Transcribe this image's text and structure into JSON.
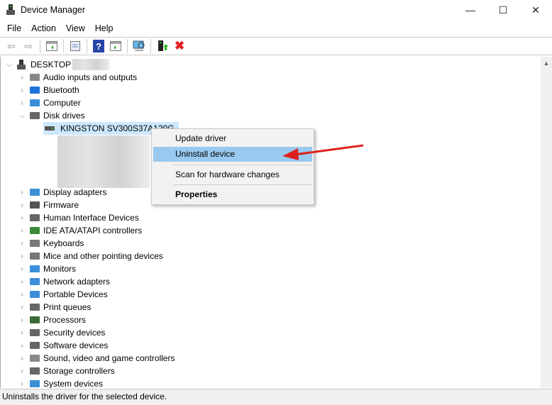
{
  "window": {
    "title": "Device Manager",
    "minimize": "—",
    "maximize": "☐",
    "close": "✕"
  },
  "menu": [
    "File",
    "Action",
    "View",
    "Help"
  ],
  "toolbar": [
    "back",
    "forward",
    "show-hide-console-tree",
    "properties",
    "help",
    "action-pane",
    "scan-hardware",
    "update-driver",
    "uninstall"
  ],
  "tree": {
    "root": "DESKTOP",
    "items": [
      {
        "label": "Audio inputs and outputs",
        "icon": "speaker-icon",
        "color": "#888"
      },
      {
        "label": "Bluetooth",
        "icon": "bluetooth-icon",
        "color": "#1e73d8"
      },
      {
        "label": "Computer",
        "icon": "computer-icon",
        "color": "#3a8fd8"
      },
      {
        "label": "Disk drives",
        "icon": "disk-icon",
        "color": "#666",
        "expanded": true
      },
      {
        "label": "Display adapters",
        "icon": "display-icon",
        "color": "#3a8fd8"
      },
      {
        "label": "Firmware",
        "icon": "chip-icon",
        "color": "#555"
      },
      {
        "label": "Human Interface Devices",
        "icon": "hid-icon",
        "color": "#666"
      },
      {
        "label": "IDE ATA/ATAPI controllers",
        "icon": "controller-icon",
        "color": "#3a8a3a"
      },
      {
        "label": "Keyboards",
        "icon": "keyboard-icon",
        "color": "#777"
      },
      {
        "label": "Mice and other pointing devices",
        "icon": "mouse-icon",
        "color": "#777"
      },
      {
        "label": "Monitors",
        "icon": "monitor-icon",
        "color": "#3a8fd8"
      },
      {
        "label": "Network adapters",
        "icon": "network-icon",
        "color": "#3a8fd8"
      },
      {
        "label": "Portable Devices",
        "icon": "portable-icon",
        "color": "#3a8fd8"
      },
      {
        "label": "Print queues",
        "icon": "printer-icon",
        "color": "#666"
      },
      {
        "label": "Processors",
        "icon": "cpu-icon",
        "color": "#3a6a3a"
      },
      {
        "label": "Security devices",
        "icon": "security-icon",
        "color": "#666"
      },
      {
        "label": "Software devices",
        "icon": "software-icon",
        "color": "#666"
      },
      {
        "label": "Sound, video and game controllers",
        "icon": "sound-icon",
        "color": "#888"
      },
      {
        "label": "Storage controllers",
        "icon": "storage-icon",
        "color": "#666"
      },
      {
        "label": "System devices",
        "icon": "system-icon",
        "color": "#3a8fd8"
      }
    ],
    "disk_children": [
      "KINGSTON SV300S37A120G"
    ]
  },
  "context_menu": {
    "items": [
      "Update driver",
      "Uninstall device",
      "Scan for hardware changes",
      "Properties"
    ],
    "highlighted": "Uninstall device"
  },
  "status": "Uninstalls the driver for the selected device.",
  "colors": {
    "highlight": "#99c9ef",
    "selection": "#cce8ff",
    "arrow": "#e02020"
  }
}
